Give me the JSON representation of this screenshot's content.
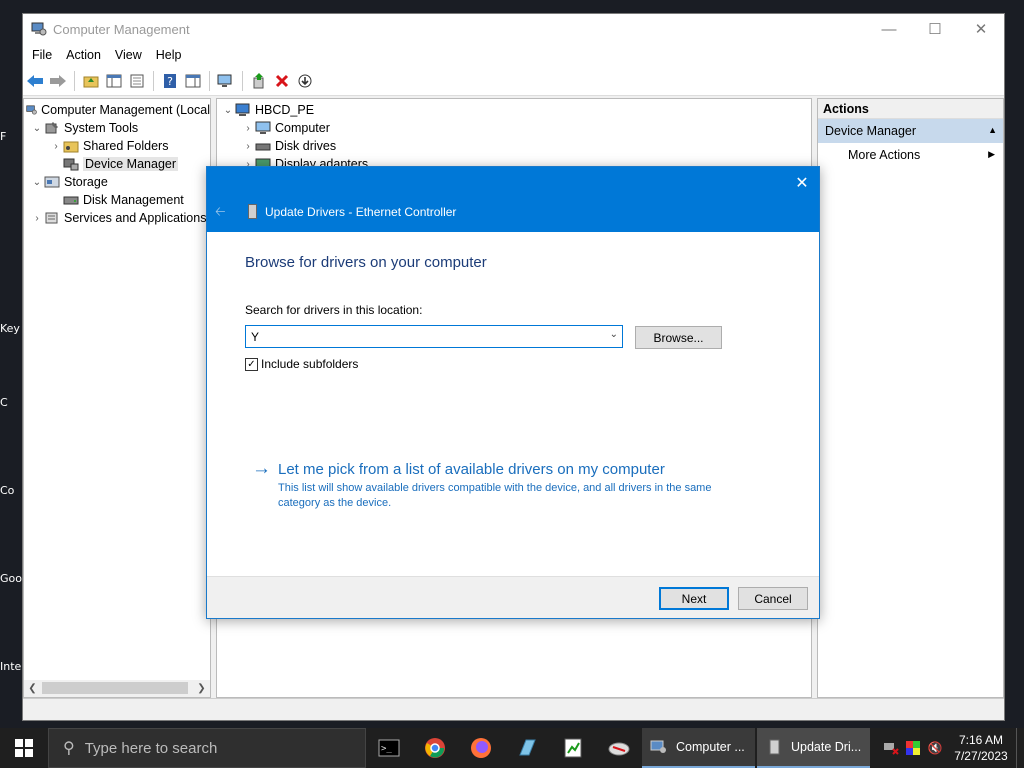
{
  "desktop": {
    "fragments": [
      "F",
      "Key",
      "C",
      "Co",
      "Goo",
      "Inte"
    ]
  },
  "window": {
    "title": "Computer Management",
    "menu": [
      "File",
      "Action",
      "View",
      "Help"
    ]
  },
  "tree": {
    "items": [
      {
        "label": "Computer Management (Local",
        "indent": 0,
        "exp": "",
        "selected": false
      },
      {
        "label": "System Tools",
        "indent": 1,
        "exp": "v",
        "selected": false
      },
      {
        "label": "Shared Folders",
        "indent": 2,
        "exp": ">",
        "selected": false
      },
      {
        "label": "Device Manager",
        "indent": 2,
        "exp": "",
        "selected": true
      },
      {
        "label": "Storage",
        "indent": 1,
        "exp": "v",
        "selected": false
      },
      {
        "label": "Disk Management",
        "indent": 2,
        "exp": "",
        "selected": false
      },
      {
        "label": "Services and Applications",
        "indent": 1,
        "exp": ">",
        "selected": false
      }
    ]
  },
  "devices": {
    "root": "HBCD_PE",
    "items": [
      "Computer",
      "Disk drives",
      "Display adapters"
    ]
  },
  "actions": {
    "header": "Actions",
    "selected": "Device Manager",
    "more": "More Actions"
  },
  "dialog": {
    "title": "Update Drivers - Ethernet Controller",
    "heading": "Browse for drivers on your computer",
    "search_label": "Search for drivers in this location:",
    "path_value": "Y",
    "browse_label": "Browse...",
    "include_subfolders": "Include subfolders",
    "link_text": "Let me pick from a list of available drivers on my computer",
    "link_desc": "This list will show available drivers compatible with the device, and all drivers in the same category as the device.",
    "next_label": "Next",
    "cancel_label": "Cancel"
  },
  "taskbar": {
    "search_placeholder": "Type here to search",
    "windows": [
      "Computer ...",
      "Update Dri..."
    ],
    "time": "7:16 AM",
    "date": "7/27/2023"
  },
  "colors": {
    "accent": "#0078d7",
    "link": "#1a6ebd",
    "heading": "#1c3c78"
  }
}
